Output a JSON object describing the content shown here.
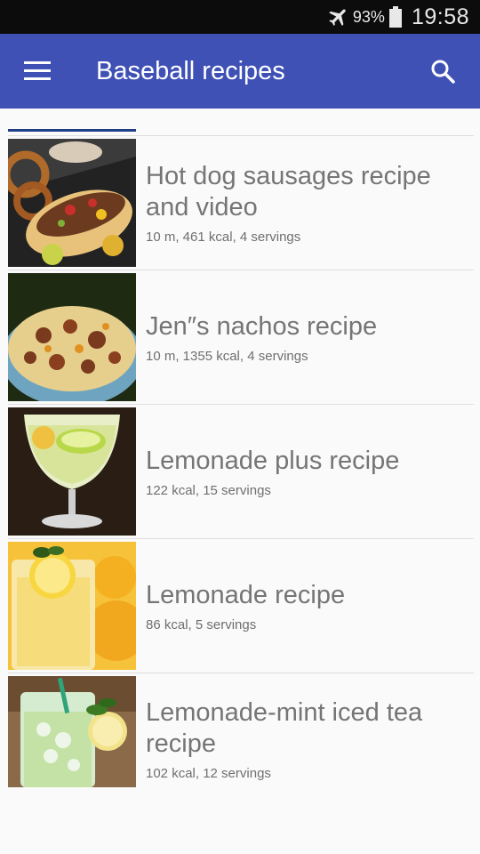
{
  "status_bar": {
    "battery_percent": "93%",
    "time": "19:58",
    "icons": [
      "airplane-mode-icon",
      "battery-icon"
    ]
  },
  "app_bar": {
    "title": "Baseball recipes",
    "menu_icon": "hamburger-menu-icon",
    "search_icon": "search-icon",
    "background": "#3f51b5"
  },
  "recipes": [
    {
      "title": "Hot dog sausages recipe and video",
      "meta": "10 m, 461 kcal, 4 servings"
    },
    {
      "title": "Jen″s nachos recipe",
      "meta": "10 m, 1355 kcal, 4 servings"
    },
    {
      "title": "Lemonade plus recipe",
      "meta": "122 kcal, 15 servings"
    },
    {
      "title": "Lemonade recipe",
      "meta": "86 kcal, 5 servings"
    },
    {
      "title": "Lemonade-mint iced tea recipe",
      "meta": "102 kcal, 12 servings"
    }
  ]
}
